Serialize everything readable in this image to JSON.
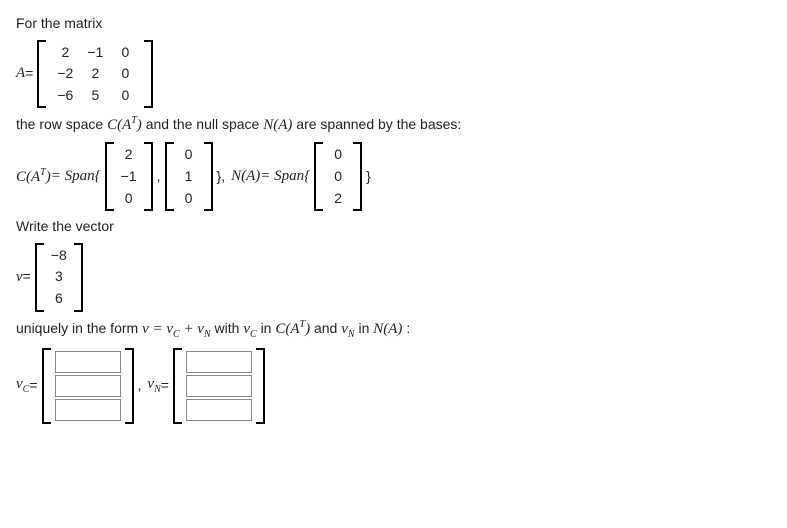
{
  "text": {
    "l1": "For the matrix",
    "A_eq": "A",
    "eq": " = ",
    "l2a": "the row space ",
    "CAT": "C(A",
    "T": "T",
    "close": ")",
    "l2b": " and the null space ",
    "NA": "N(A)",
    "l2c": " are spanned by the bases:",
    "span_eq": " = Span{ ",
    "comma": ", ",
    "closebr": "}",
    "l3": "Write the vector",
    "v": "v",
    "l4a": "uniquely in the form ",
    "vform": "v = v",
    "Csub": "C",
    "plus": " + v",
    "Nsub": "N",
    "l4b": " with ",
    "vC": "v",
    "l4c": " in ",
    "l4d": " and ",
    "vN": "v",
    "l4e": " :"
  },
  "matrix_A": [
    [
      "2",
      "−1",
      "0"
    ],
    [
      "−2",
      "2",
      "0"
    ],
    [
      "−6",
      "5",
      "0"
    ]
  ],
  "rowspace_basis": [
    [
      "2",
      "−1",
      "0"
    ],
    [
      "0",
      "1",
      "0"
    ]
  ],
  "nullspace_basis": [
    [
      "0",
      "0",
      "2"
    ]
  ],
  "vector_v": [
    "−8",
    "3",
    "6"
  ],
  "answers": {
    "vC": [
      "",
      "",
      ""
    ],
    "vN": [
      "",
      "",
      ""
    ]
  },
  "chart_data": {
    "type": "table",
    "description": "Linear algebra decomposition problem",
    "A": [
      [
        2,
        -1,
        0
      ],
      [
        -2,
        2,
        0
      ],
      [
        -6,
        5,
        0
      ]
    ],
    "row_space_basis": [
      [
        2,
        -1,
        0
      ],
      [
        0,
        1,
        0
      ]
    ],
    "null_space_basis": [
      [
        0,
        0,
        2
      ]
    ],
    "v": [
      -8,
      3,
      6
    ],
    "unknowns": [
      "vC (3x1)",
      "vN (3x1)"
    ]
  }
}
